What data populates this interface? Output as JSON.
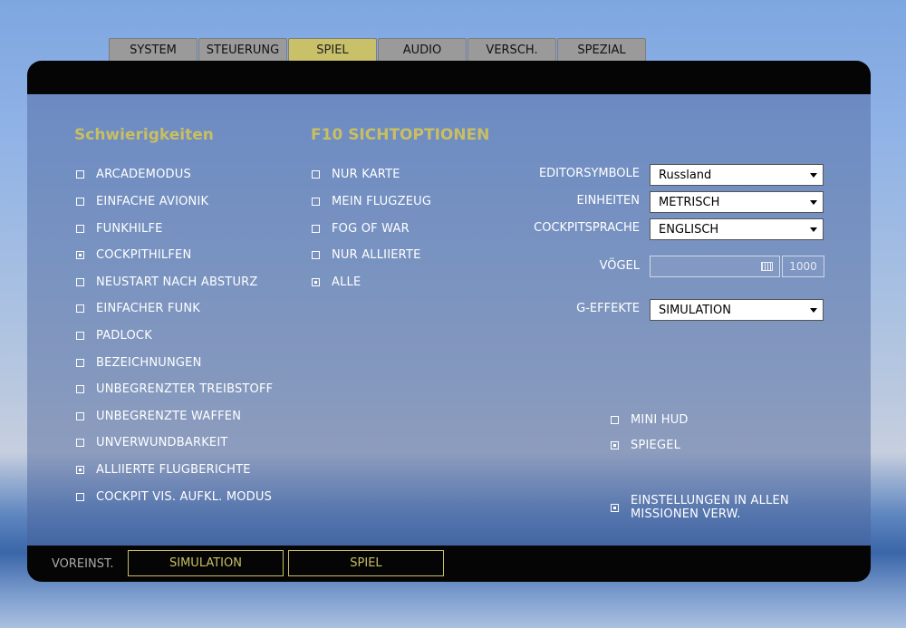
{
  "tabs": [
    {
      "label": "SYSTEM"
    },
    {
      "label": "STEUERUNG"
    },
    {
      "label": "SPIEL",
      "active": true
    },
    {
      "label": "AUDIO"
    },
    {
      "label": "VERSCH."
    },
    {
      "label": "SPEZIAL"
    }
  ],
  "difficulties": {
    "title": "Schwierigkeiten",
    "items": [
      {
        "label": "ARCADEMODUS",
        "checked": false
      },
      {
        "label": "EINFACHE AVIONIK",
        "checked": false
      },
      {
        "label": "FUNKHILFE",
        "checked": false
      },
      {
        "label": "COCKPITHILFEN",
        "checked": true
      },
      {
        "label": "NEUSTART NACH ABSTURZ",
        "checked": false
      },
      {
        "label": "EINFACHER FUNK",
        "checked": false
      },
      {
        "label": "PADLOCK",
        "checked": false
      },
      {
        "label": "BEZEICHNUNGEN",
        "checked": false
      },
      {
        "label": "UNBEGRENZTER TREIBSTOFF",
        "checked": false
      },
      {
        "label": "UNBEGRENZTE WAFFEN",
        "checked": false
      },
      {
        "label": "UNVERWUNDBARKEIT",
        "checked": false
      },
      {
        "label": "ALLIIERTE FLUGBERICHTE",
        "checked": true
      },
      {
        "label": "COCKPIT VIS. AUFKL. MODUS",
        "checked": false
      }
    ]
  },
  "f10": {
    "title": "F10 SICHTOPTIONEN",
    "items": [
      {
        "label": "NUR KARTE",
        "checked": false
      },
      {
        "label": "MEIN FLUGZEUG",
        "checked": false
      },
      {
        "label": "FOG OF WAR",
        "checked": false
      },
      {
        "label": "NUR ALLIIERTE",
        "checked": false
      },
      {
        "label": "ALLE",
        "checked": true
      }
    ]
  },
  "settings": {
    "editorsymbole": {
      "label": "EDITORSYMBOLE",
      "value": "Russland"
    },
    "einheiten": {
      "label": "EINHEITEN",
      "value": "METRISCH"
    },
    "cockpitsprache": {
      "label": "COCKPITSPRACHE",
      "value": "ENGLISCH"
    },
    "voegel": {
      "label": "VÖGEL",
      "value": "1000"
    },
    "geffekte": {
      "label": "G-EFFEKTE",
      "value": "SIMULATION"
    }
  },
  "misc": [
    {
      "label": "MINI HUD",
      "checked": false
    },
    {
      "label": "SPIEGEL",
      "checked": true
    },
    {
      "label": "EINSTELLUNGEN IN ALLEN MISSIONEN VERW.",
      "checked": true
    }
  ],
  "presets": {
    "label": "VOREINST.",
    "buttons": [
      {
        "label": "SIMULATION"
      },
      {
        "label": "SPIEL"
      }
    ]
  },
  "colors": {
    "accent": "#c9bf62",
    "active_tab": "#c9c06a",
    "tab": "#9a9a9a"
  }
}
